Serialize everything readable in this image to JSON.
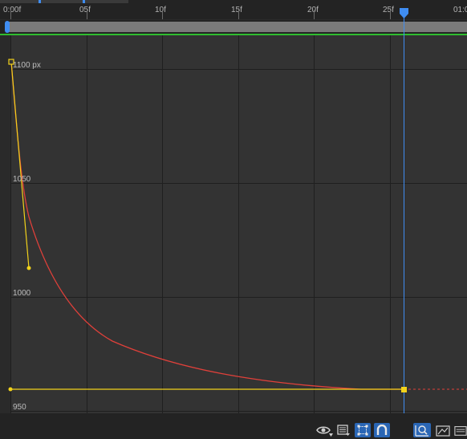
{
  "ruler": {
    "ticks": [
      {
        "label": "0:00f"
      },
      {
        "label": "05f"
      },
      {
        "label": "10f"
      },
      {
        "label": "15f"
      },
      {
        "label": "20f"
      },
      {
        "label": "25f"
      },
      {
        "label": "01:0"
      }
    ]
  },
  "graph": {
    "value_labels": {
      "v1100": "1100 px",
      "v1050": "1050",
      "v1000": "1000",
      "v950": "950"
    },
    "curve_color": "#e0403a",
    "handle_color": "#f2d21b",
    "playhead_color": "#3f8df2"
  },
  "toolbar": {
    "icons": [
      "eye-icon",
      "graph-type-icon",
      "transform-box-icon",
      "snap-icon",
      "fit-selection-icon",
      "fit-all-icon",
      "zoom-all-icon"
    ]
  }
}
